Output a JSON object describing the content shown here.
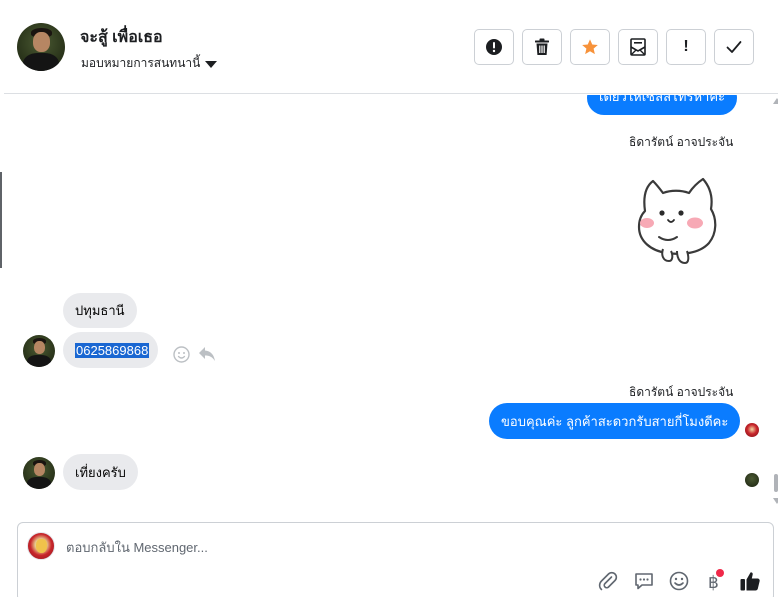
{
  "header": {
    "contact_name": "จะสู้ เพื่อเธอ",
    "assign_label": "มอบหมายการสนทนานี้",
    "actions": [
      {
        "icon": "alert-circle-icon",
        "label": ""
      },
      {
        "icon": "trash-icon",
        "label": ""
      },
      {
        "icon": "star-icon",
        "label": ""
      },
      {
        "icon": "mark-unread-icon",
        "label": ""
      },
      {
        "icon": "exclamation-icon",
        "label": "!"
      },
      {
        "icon": "check-icon",
        "label": ""
      }
    ],
    "star_color": "#f7923a"
  },
  "messages": {
    "m1_text": "เดี๋ยวให้เซลล์โทรหาค่ะ",
    "m2_sender": "ธิดารัตน์ อาจประจัน",
    "m2_sticker": "cat-sticker",
    "m3_text": "ปทุมธานี",
    "m4_text": "0625869868",
    "m5_sender": "ธิดารัตน์ อาจประจัน",
    "m5_text": "ขอบคุณค่ะ ลูกค้าสะดวกรับสายกี่โมงดีคะ",
    "m6_text": "เที่ยงครับ"
  },
  "composer": {
    "placeholder": "ตอบกลับใน Messenger...",
    "tools": [
      "paperclip-icon",
      "saved-replies-icon",
      "emoji-icon",
      "baht-payment-icon",
      "like-icon"
    ]
  },
  "colors": {
    "outgoing_bubble": "#0a7cff",
    "incoming_bubble": "#e9eaed",
    "selection": "#1a67d2",
    "notification_dot": "#f02849"
  }
}
